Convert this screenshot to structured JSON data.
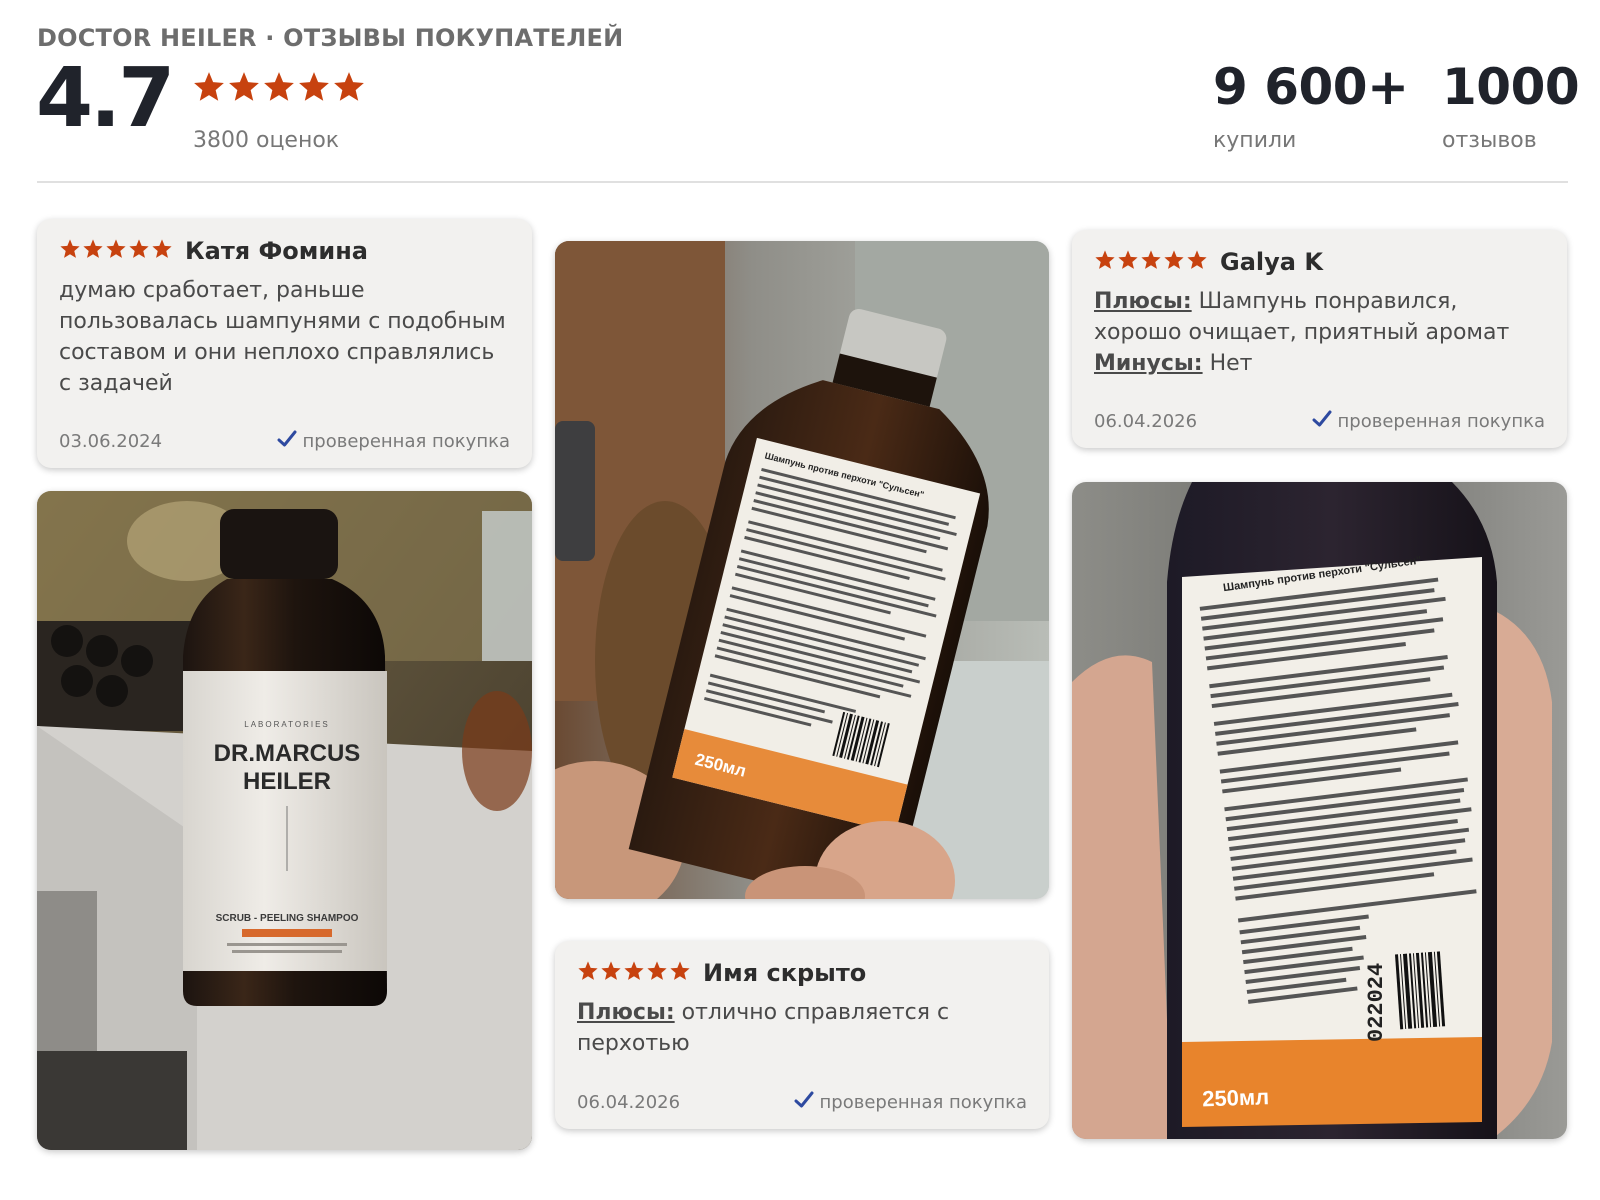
{
  "header": {
    "title": "DOCTOR HEILER · ОТЗЫВЫ ПОКУПАТЕЛЕЙ",
    "rating": "4.7",
    "rating_count": "3800 оценок",
    "bought_value": "9 600+",
    "bought_label": "купили",
    "reviews_value": "1000",
    "reviews_label": "отзывов",
    "stars": 5,
    "star_color": "#c7420f"
  },
  "reviews": [
    {
      "author": "Катя Фомина",
      "text": "думаю сработает, раньше пользовалась шампунями с подобным составом и они неплохо справлялись с задачей",
      "date": "03.06.2024",
      "verified": "проверенная покупка",
      "stars": 5
    },
    {
      "author": "Имя скрыто",
      "pros_label": "Плюсы:",
      "pros": "отлично справляется с перхотью",
      "date": "06.04.2026",
      "verified": "проверенная покупка",
      "stars": 5
    },
    {
      "author": "Galya K",
      "pros_label": "Плюсы:",
      "pros": "Шампунь понравился, хорошо очищает, приятный аромат",
      "cons_label": "Минусы:",
      "cons": "Нет",
      "date": "06.04.2026",
      "verified": "проверенная покупка",
      "stars": 5
    }
  ],
  "photos": {
    "front": {
      "brand_small": "LABORATORIES",
      "brand_line1": "DR.MARCUS",
      "brand_line2": "HEILER",
      "product": "SCRUB - PEELING SHAMPOO"
    },
    "back_title": "Шампунь против перхоти \"Сульсен\"",
    "volume": "250мл",
    "batch_number": "022024"
  }
}
